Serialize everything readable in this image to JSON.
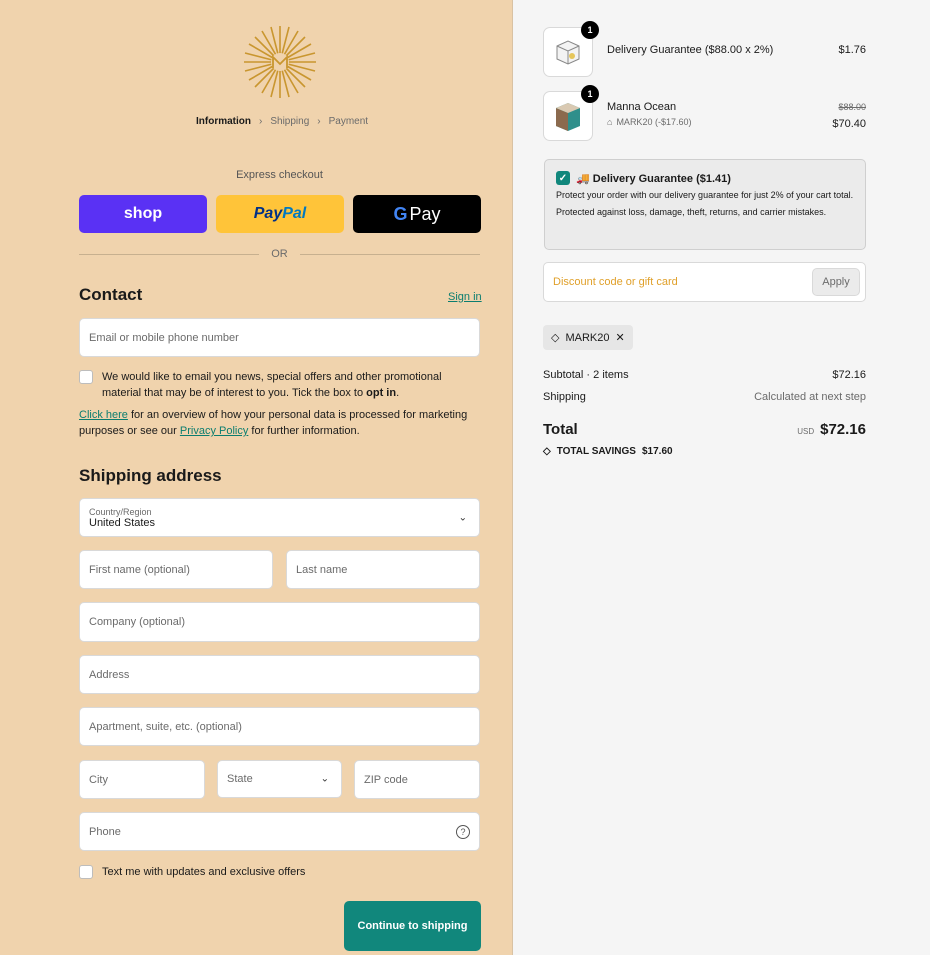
{
  "breadcrumb": {
    "step1": "Information",
    "step2": "Shipping",
    "step3": "Payment"
  },
  "express": {
    "label": "Express checkout",
    "shop_label": "shop",
    "paypal_pay": "Pay",
    "paypal_pal": "Pal",
    "gpay_label": "Pay",
    "or_label": "OR"
  },
  "contact": {
    "title": "Contact",
    "signin": "Sign in",
    "email_placeholder": "Email or mobile phone number",
    "marketing_text_1": "We would like to email you news, special offers and other promotional material that may be of interest to you. Tick the box to ",
    "marketing_optin": "opt in",
    "marketing_text_2": ".",
    "info_link": "Click here",
    "info_text_1": " for an overview of how your personal data is processed for marketing purposes or see our ",
    "privacy_link": "Privacy Policy",
    "info_text_2": " for further information."
  },
  "shipping": {
    "title": "Shipping address",
    "country_label": "Country/Region",
    "country_value": "United States",
    "first_name": "First name (optional)",
    "last_name": "Last name",
    "company": "Company (optional)",
    "address": "Address",
    "apartment": "Apartment, suite, etc. (optional)",
    "city": "City",
    "state": "State",
    "zip": "ZIP code",
    "phone": "Phone",
    "sms_text": "Text me with updates and exclusive offers",
    "continue_label": "Continue to shipping"
  },
  "cart": {
    "items": [
      {
        "name": "Delivery Guarantee ($88.00 x 2%)",
        "price": "$1.76",
        "qty": "1"
      },
      {
        "name": "Manna Ocean",
        "original_price": "$88.00",
        "price": "$70.40",
        "qty": "1",
        "discount": "MARK20 (-$17.60)"
      }
    ],
    "guarantee": {
      "title": "🚚 Delivery Guarantee ($1.41)",
      "body": "Protect your order with our delivery guarantee for just 2% of your cart total. Protected against loss, damage, theft, returns, and carrier mistakes."
    },
    "discount_placeholder": "Discount code or gift card",
    "apply_label": "Apply",
    "applied_code": "MARK20",
    "subtotal_label": "Subtotal · 2 items",
    "subtotal_value": "$72.16",
    "shipping_label": "Shipping",
    "shipping_value": "Calculated at next step",
    "total_label": "Total",
    "currency": "USD",
    "total_value": "$72.16",
    "savings_label": "TOTAL SAVINGS",
    "savings_value": "$17.60"
  },
  "colors": {
    "left_bg": "#f0d3ad",
    "accent": "#11877c",
    "shop": "#5a31f4",
    "paypal": "#ffc439"
  }
}
